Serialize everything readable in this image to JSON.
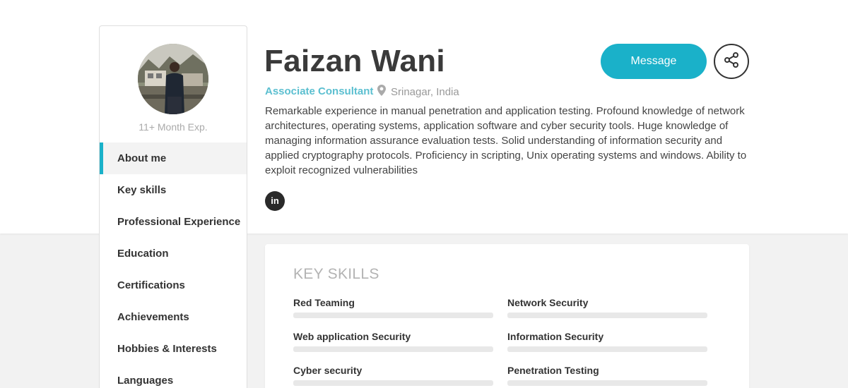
{
  "profile": {
    "name": "Faizan Wani",
    "role": "Associate Consultant",
    "location": "Srinagar, India",
    "experience": "11+ Month Exp.",
    "bio": "Remarkable experience in manual penetration and application testing. Profound knowledge of network architectures, operating systems, application software and cyber security tools. Huge knowledge of managing information assurance evaluation tests. Solid understanding of information security and applied cryptography protocols. Proficiency in scripting, Unix operating systems and windows. Ability to exploit recognized vulnerabilities",
    "linkedin_label": "in"
  },
  "actions": {
    "message_label": "Message",
    "share_icon": "share-icon"
  },
  "sidebar": {
    "items": [
      {
        "label": "About me",
        "active": true
      },
      {
        "label": "Key skills"
      },
      {
        "label": "Professional Experience"
      },
      {
        "label": "Education"
      },
      {
        "label": "Certifications"
      },
      {
        "label": "Achievements"
      },
      {
        "label": "Hobbies & Interests"
      },
      {
        "label": "Languages"
      }
    ]
  },
  "key_skills": {
    "title": "KEY SKILLS",
    "skills": [
      {
        "label": "Red Teaming",
        "level": 0
      },
      {
        "label": "Network Security",
        "level": 0
      },
      {
        "label": "Web application Security",
        "level": 0
      },
      {
        "label": "Information Security",
        "level": 0
      },
      {
        "label": "Cyber security",
        "level": 0
      },
      {
        "label": "Penetration Testing",
        "level": 0
      }
    ]
  },
  "colors": {
    "accent": "#1ab1c9",
    "role_text": "#5bbfd0",
    "bar_track": "#e8e8e8"
  }
}
